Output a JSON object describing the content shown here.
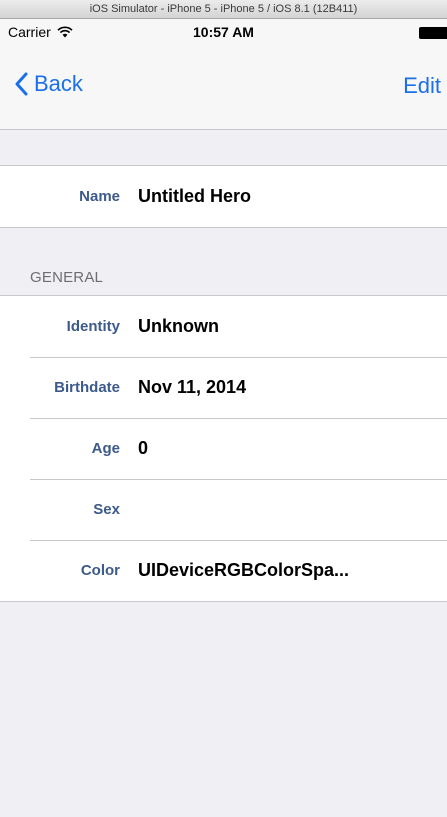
{
  "simulator": {
    "title": "iOS Simulator - iPhone 5 - iPhone 5 / iOS 8.1 (12B411)"
  },
  "status_bar": {
    "carrier": "Carrier",
    "time": "10:57 AM"
  },
  "nav": {
    "back_label": "Back",
    "edit_label": "Edit",
    "tint_color": "#1a6fea"
  },
  "name_row": {
    "label": "Name",
    "value": "Untitled Hero"
  },
  "general_section": {
    "title": "GENERAL",
    "rows": [
      {
        "label": "Identity",
        "value": "Unknown"
      },
      {
        "label": "Birthdate",
        "value": "Nov 11, 2014"
      },
      {
        "label": "Age",
        "value": "0"
      },
      {
        "label": "Sex",
        "value": ""
      },
      {
        "label": "Color",
        "value": "UIDeviceRGBColorSpa..."
      }
    ]
  }
}
